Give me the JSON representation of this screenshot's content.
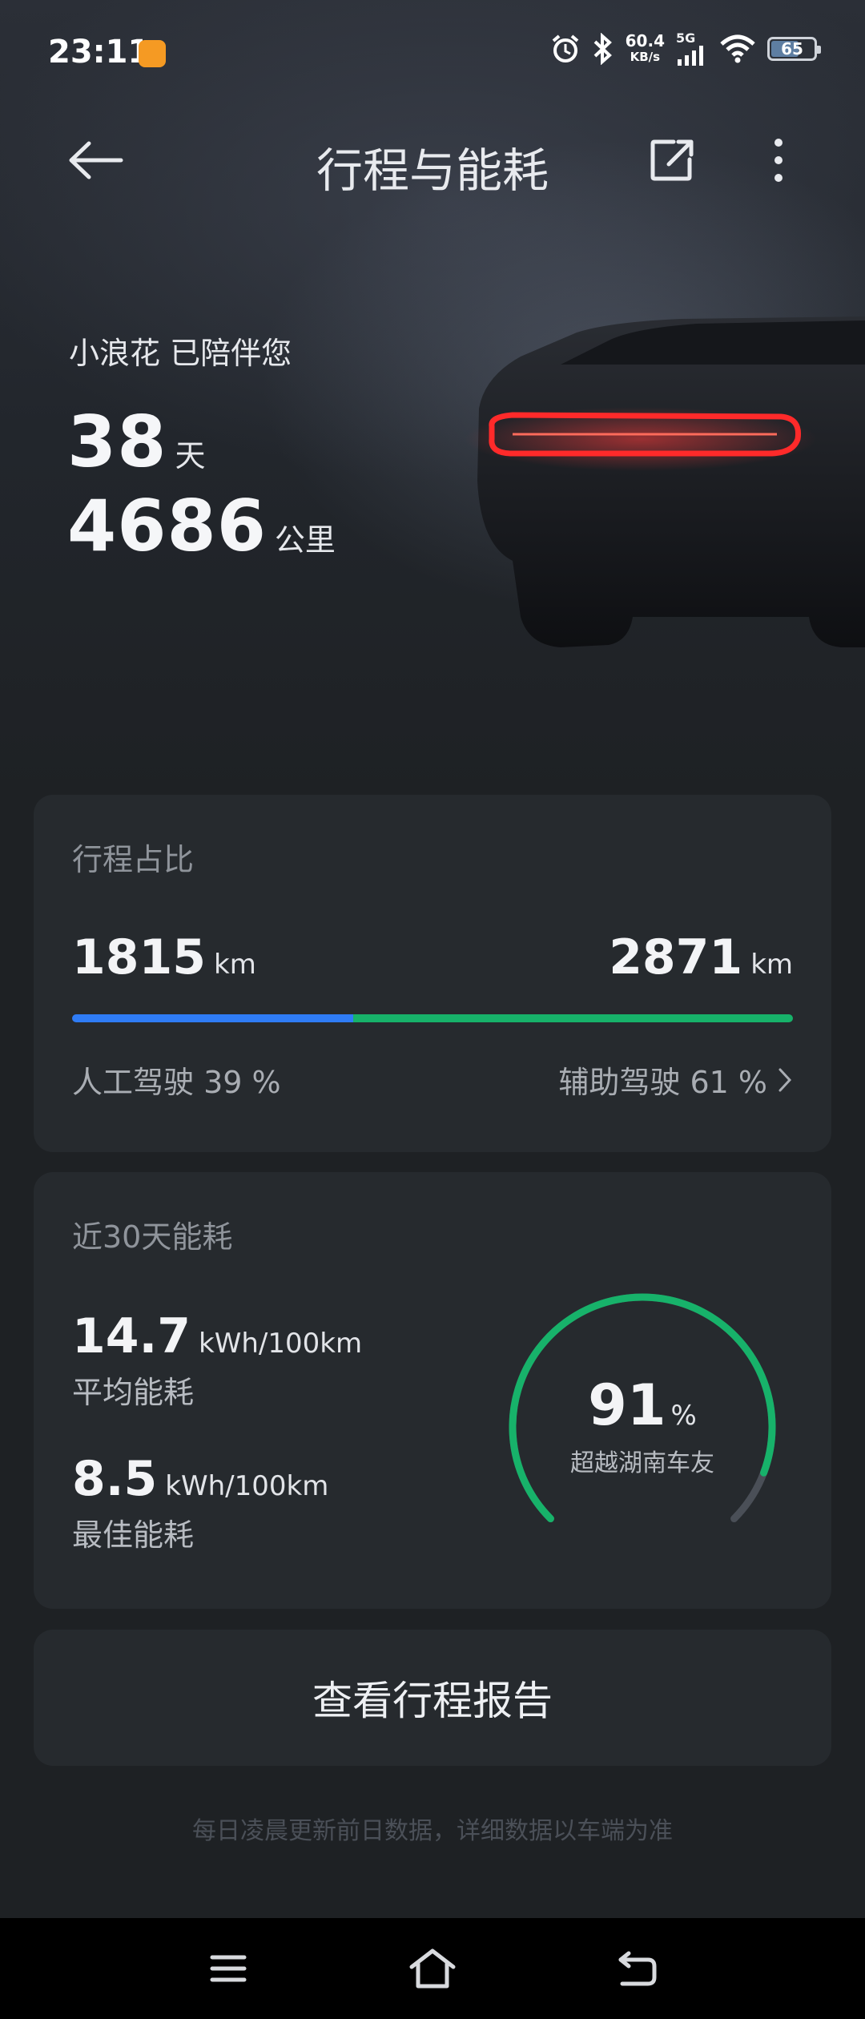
{
  "status_bar": {
    "time": "23:11",
    "net_speed_value": "60.4",
    "net_speed_unit": "KB/s",
    "network": "5G",
    "battery": "65",
    "battery_level": 0.65
  },
  "header": {
    "title": "行程与能耗"
  },
  "hero": {
    "companion_text": "小浪花 已陪伴您",
    "days_value": "38",
    "days_unit": "天",
    "distance_value": "4686",
    "distance_unit": "公里"
  },
  "trip_card": {
    "title": "行程占比",
    "manual_km": "1815",
    "assist_km": "2871",
    "km_unit": "km",
    "manual_label": "人工驾驶 39 %",
    "assist_label": "辅助驾驶 61 %",
    "manual_ratio": 0.39,
    "assist_ratio": 0.61
  },
  "energy_card": {
    "title": "近30天能耗",
    "avg_value": "14.7",
    "avg_unit": "kWh/100km",
    "avg_label": "平均能耗",
    "best_value": "8.5",
    "best_unit": "kWh/100km",
    "best_label": "最佳能耗",
    "percentile_value": "91",
    "percentile_unit": "%",
    "percentile_label": "超越湖南车友",
    "percentile_ratio": 0.91
  },
  "report_button": "查看行程报告",
  "footnote": "每日凌晨更新前日数据，详细数据以车端为准",
  "colors": {
    "manual": "#2f7cf6",
    "assist": "#17b26a",
    "gauge": "#17b26a",
    "gauge_track": "#4a4f57"
  }
}
